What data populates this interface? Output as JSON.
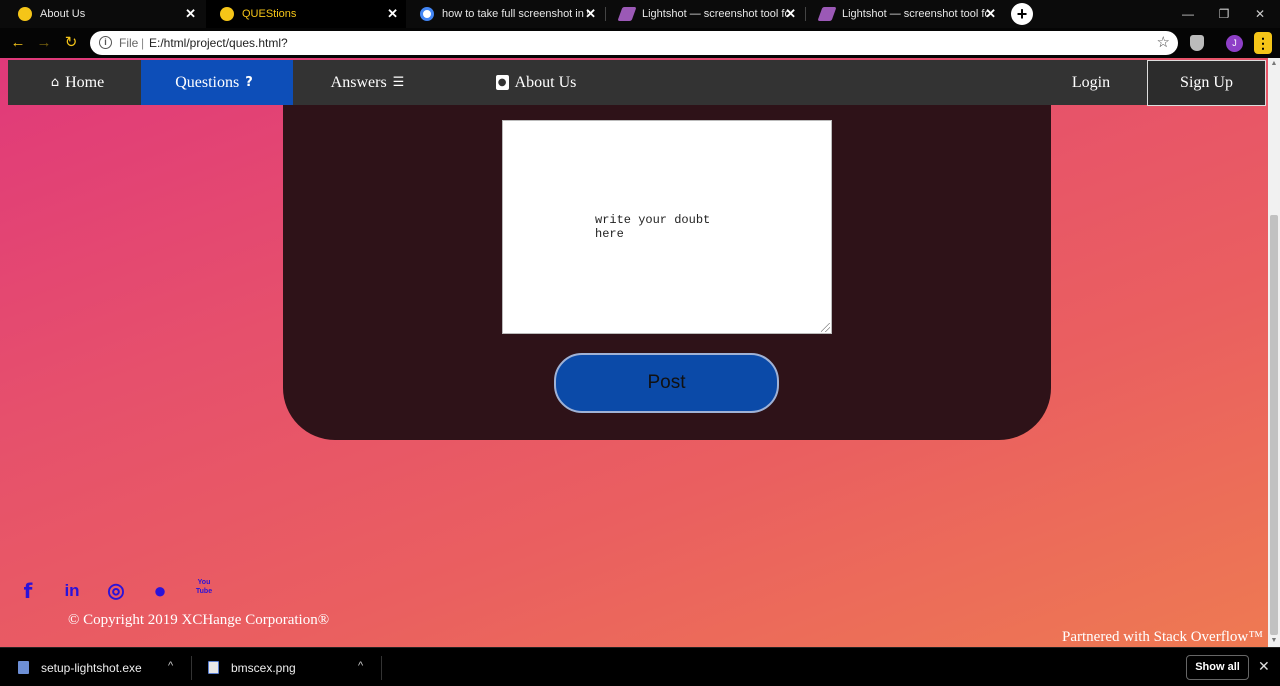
{
  "browser": {
    "tabs": [
      {
        "title": "About Us",
        "icon": "site-globe-icon",
        "active": false
      },
      {
        "title": "QUEStions",
        "icon": "site-globe-icon",
        "active": true
      },
      {
        "title": "how to take full screenshot in wir",
        "icon": "google-icon",
        "active": false
      },
      {
        "title": "Lightshot — screenshot tool for M",
        "icon": "lightshot-feather-icon",
        "active": false
      },
      {
        "title": "Lightshot — screenshot tool for M",
        "icon": "lightshot-feather-icon",
        "active": false
      }
    ],
    "new_tab": "+",
    "address": {
      "scheme": "File",
      "separator": "|",
      "url": "E:/html/project/ques.html?"
    },
    "profile_initial": "J"
  },
  "nav": {
    "items": [
      {
        "label": "Home",
        "icon": "home-icon",
        "active": false
      },
      {
        "label": "Questions",
        "icon": "question-icon",
        "active": true
      },
      {
        "label": "Answers",
        "icon": "list-icon",
        "active": false
      },
      {
        "label": "About Us",
        "icon": "contact-book-icon",
        "active": false
      }
    ],
    "login": "Login",
    "signup": "Sign Up"
  },
  "form": {
    "doubt_text": "write your doubt\nhere",
    "post_label": "Post"
  },
  "footer": {
    "social": [
      {
        "name": "facebook-icon",
        "glyph": "f"
      },
      {
        "name": "linkedin-icon",
        "glyph": "in"
      },
      {
        "name": "instagram-icon",
        "glyph": "◎"
      },
      {
        "name": "reddit-icon",
        "glyph": "●"
      },
      {
        "name": "youtube-icon",
        "glyph": "You Tube"
      }
    ],
    "copyright": "© Copyright 2019 XCHange Corporation®",
    "partner": "Partnered with Stack Overflow™"
  },
  "downloads": {
    "files": [
      {
        "name": "setup-lightshot.exe",
        "icon": "exe-file-icon"
      },
      {
        "name": "bmscex.png",
        "icon": "image-file-icon"
      }
    ],
    "show_all": "Show all"
  },
  "colors": {
    "nav_active": "#0d4eb8",
    "panel": "#2e1218",
    "post_button": "#0b4aa8",
    "social_icons": "#2b12d9",
    "accent_chrome": "#f5c518"
  }
}
